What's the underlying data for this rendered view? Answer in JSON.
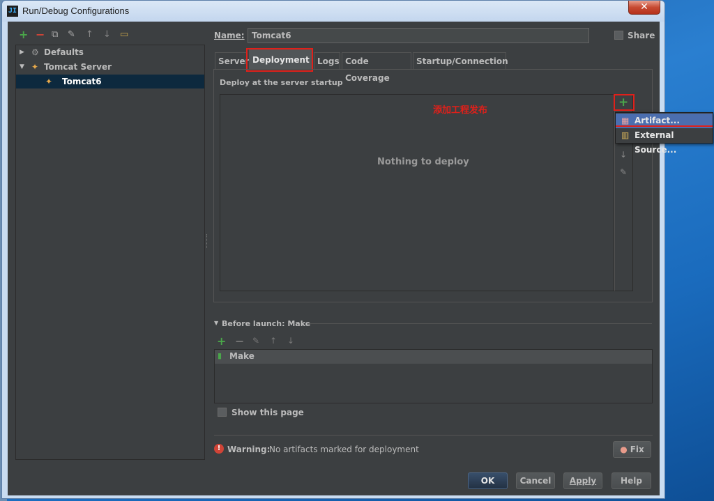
{
  "window": {
    "title": "Run/Debug Configurations",
    "icon_text": "JI",
    "close_label": "✕"
  },
  "left_toolbar": {
    "icons": [
      "plus-icon",
      "minus-icon",
      "copy-icon",
      "wrench-icon",
      "arrow-up-icon",
      "arrow-down-icon",
      "folder-icon"
    ]
  },
  "tree": {
    "items": [
      {
        "label": "Defaults",
        "expanded": false,
        "selected": false
      },
      {
        "label": "Tomcat Server",
        "expanded": true,
        "selected": false
      },
      {
        "label": "Tomcat6",
        "expanded": false,
        "selected": true
      }
    ]
  },
  "form": {
    "name_label": "Name:",
    "name_value": "Tomcat6",
    "share_label": "Share",
    "share_checked": false
  },
  "tabs": [
    {
      "label": "Server",
      "active": false
    },
    {
      "label": "Deployment",
      "active": true
    },
    {
      "label": "Logs",
      "active": false
    },
    {
      "label": "Code Coverage",
      "active": false
    },
    {
      "label": "Startup/Connection",
      "active": false
    }
  ],
  "deployment": {
    "section_label": "Deploy at the server startup",
    "empty_text": "Nothing to deploy",
    "annotation": "添加工程发布",
    "popup": {
      "items": [
        {
          "label": "Artifact...",
          "highlighted": true
        },
        {
          "label": "External Source...",
          "highlighted": false
        }
      ]
    }
  },
  "before_launch": {
    "label": "Before launch: Make",
    "items": [
      {
        "label": "Make"
      }
    ]
  },
  "show_page": {
    "label": "Show this page",
    "checked": false
  },
  "warning": {
    "prefix": "Warning:",
    "text": "No artifacts marked for deployment",
    "fix_label": "Fix"
  },
  "buttons": {
    "ok": "OK",
    "cancel": "Cancel",
    "apply": "Apply",
    "help": "Help"
  },
  "colors": {
    "accent_green": "#499c54",
    "highlight_red": "#e0201a",
    "selection_blue": "#4b6eaf",
    "tree_selection": "#0d293e"
  }
}
